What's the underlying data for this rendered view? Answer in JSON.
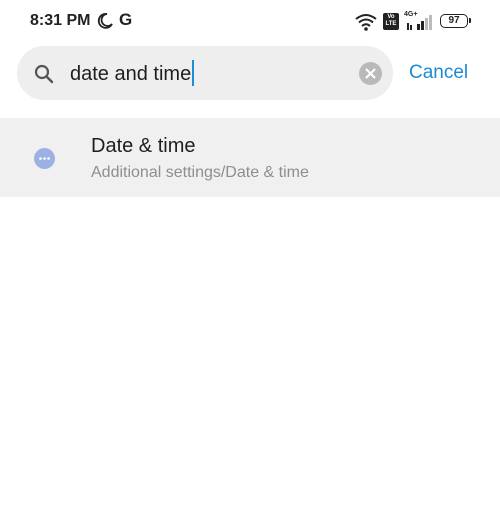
{
  "status_bar": {
    "time": "8:31 PM",
    "moon_icon": "moon-icon",
    "g_label": "G",
    "wifi_icon": "wifi-icon",
    "volte_top": "Vo",
    "volte_bottom": "LTE",
    "network_label": "4G+",
    "signal_icon": "signal-icon",
    "battery_level": "97"
  },
  "search": {
    "query": "date and time",
    "search_icon": "search-icon",
    "clear_icon": "clear-icon",
    "cancel_label": "Cancel"
  },
  "results": [
    {
      "icon": "more-dots-icon",
      "title": "Date & time",
      "path": "Additional settings/Date & time"
    }
  ],
  "colors": {
    "accent": "#1b8ad3",
    "search_bg": "#eeeeee",
    "result_bg": "#f0f0f0",
    "result_icon": "#9db0e3",
    "subtitle": "#8e8e8e"
  }
}
